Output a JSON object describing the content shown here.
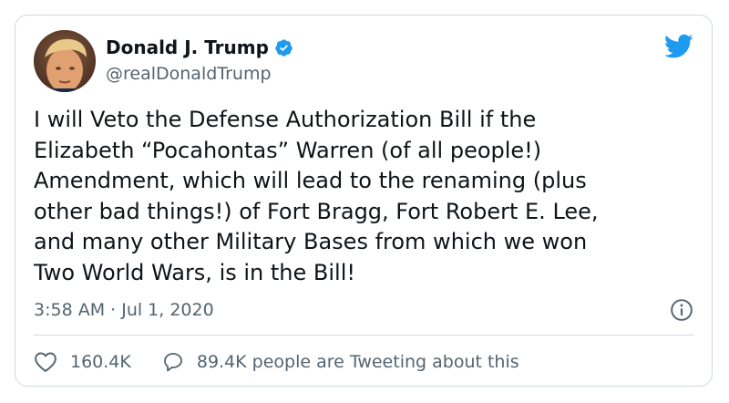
{
  "tweet": {
    "author": {
      "display_name": "Donald J. Trump",
      "handle": "@realDonaldTrump",
      "verified": true,
      "avatar_icon": "profile-photo"
    },
    "text": "I will Veto the Defense Authorization Bill if the\nElizabeth “Pocahontas” Warren (of all people!)\nAmendment, which will lead to the renaming (plus\nother bad things!) of Fort Bragg, Fort Robert E. Lee,\nand many other Military Bases from which we won\nTwo World Wars, is in the Bill!",
    "timestamp": "3:58 AM · Jul 1, 2020",
    "likes": "160.4K",
    "conversation": "89.4K people are Tweeting about this",
    "icons": {
      "brand": "twitter-bird-icon",
      "verified": "verified-badge-icon",
      "info": "info-icon",
      "like": "heart-icon",
      "reply": "speech-bubble-icon"
    }
  },
  "colors": {
    "brand": "#1d9bf0",
    "text_primary": "#0f1419",
    "text_secondary": "#536471",
    "border": "#cfd9de"
  }
}
